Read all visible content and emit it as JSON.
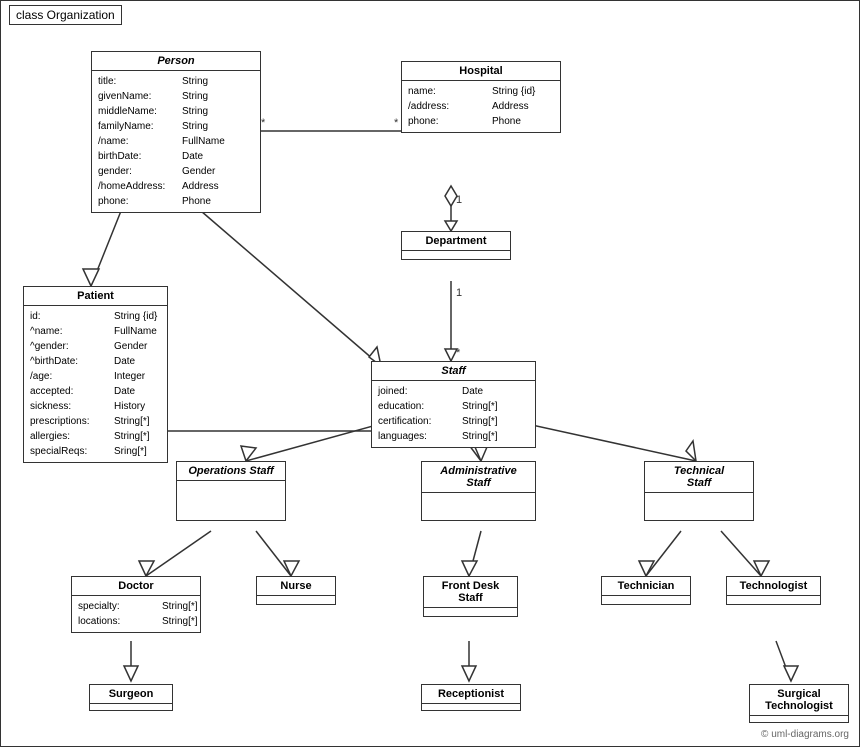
{
  "diagram": {
    "title": "class Organization",
    "classes": {
      "person": {
        "name": "Person",
        "italic": true,
        "attrs": [
          {
            "name": "title:",
            "type": "String"
          },
          {
            "name": "givenName:",
            "type": "String"
          },
          {
            "name": "middleName:",
            "type": "String"
          },
          {
            "name": "familyName:",
            "type": "String"
          },
          {
            "name": "/name:",
            "type": "FullName"
          },
          {
            "name": "birthDate:",
            "type": "Date"
          },
          {
            "name": "gender:",
            "type": "Gender"
          },
          {
            "name": "/homeAddress:",
            "type": "Address"
          },
          {
            "name": "phone:",
            "type": "Phone"
          }
        ]
      },
      "hospital": {
        "name": "Hospital",
        "italic": false,
        "attrs": [
          {
            "name": "name:",
            "type": "String {id}"
          },
          {
            "name": "/address:",
            "type": "Address"
          },
          {
            "name": "phone:",
            "type": "Phone"
          }
        ]
      },
      "department": {
        "name": "Department",
        "italic": false,
        "attrs": []
      },
      "staff": {
        "name": "Staff",
        "italic": true,
        "attrs": [
          {
            "name": "joined:",
            "type": "Date"
          },
          {
            "name": "education:",
            "type": "String[*]"
          },
          {
            "name": "certification:",
            "type": "String[*]"
          },
          {
            "name": "languages:",
            "type": "String[*]"
          }
        ]
      },
      "patient": {
        "name": "Patient",
        "italic": false,
        "attrs": [
          {
            "name": "id:",
            "type": "String {id}"
          },
          {
            "name": "^name:",
            "type": "FullName"
          },
          {
            "name": "^gender:",
            "type": "Gender"
          },
          {
            "name": "^birthDate:",
            "type": "Date"
          },
          {
            "name": "/age:",
            "type": "Integer"
          },
          {
            "name": "accepted:",
            "type": "Date"
          },
          {
            "name": "sickness:",
            "type": "History"
          },
          {
            "name": "prescriptions:",
            "type": "String[*]"
          },
          {
            "name": "allergies:",
            "type": "String[*]"
          },
          {
            "name": "specialReqs:",
            "type": "Sring[*]"
          }
        ]
      },
      "operationsStaff": {
        "name": "Operations Staff",
        "italic": true,
        "attrs": []
      },
      "administrativeStaff": {
        "name": "Administrative Staff",
        "italic": true,
        "attrs": []
      },
      "technicalStaff": {
        "name": "Technical Staff",
        "italic": true,
        "attrs": []
      },
      "doctor": {
        "name": "Doctor",
        "italic": false,
        "attrs": [
          {
            "name": "specialty:",
            "type": "String[*]"
          },
          {
            "name": "locations:",
            "type": "String[*]"
          }
        ]
      },
      "nurse": {
        "name": "Nurse",
        "italic": false,
        "attrs": []
      },
      "frontDeskStaff": {
        "name": "Front Desk Staff",
        "italic": false,
        "attrs": []
      },
      "technician": {
        "name": "Technician",
        "italic": false,
        "attrs": []
      },
      "technologist": {
        "name": "Technologist",
        "italic": false,
        "attrs": []
      },
      "surgeon": {
        "name": "Surgeon",
        "italic": false,
        "attrs": []
      },
      "receptionist": {
        "name": "Receptionist",
        "italic": false,
        "attrs": []
      },
      "surgicalTechnologist": {
        "name": "Surgical Technologist",
        "italic": false,
        "attrs": []
      }
    },
    "copyright": "© uml-diagrams.org"
  }
}
